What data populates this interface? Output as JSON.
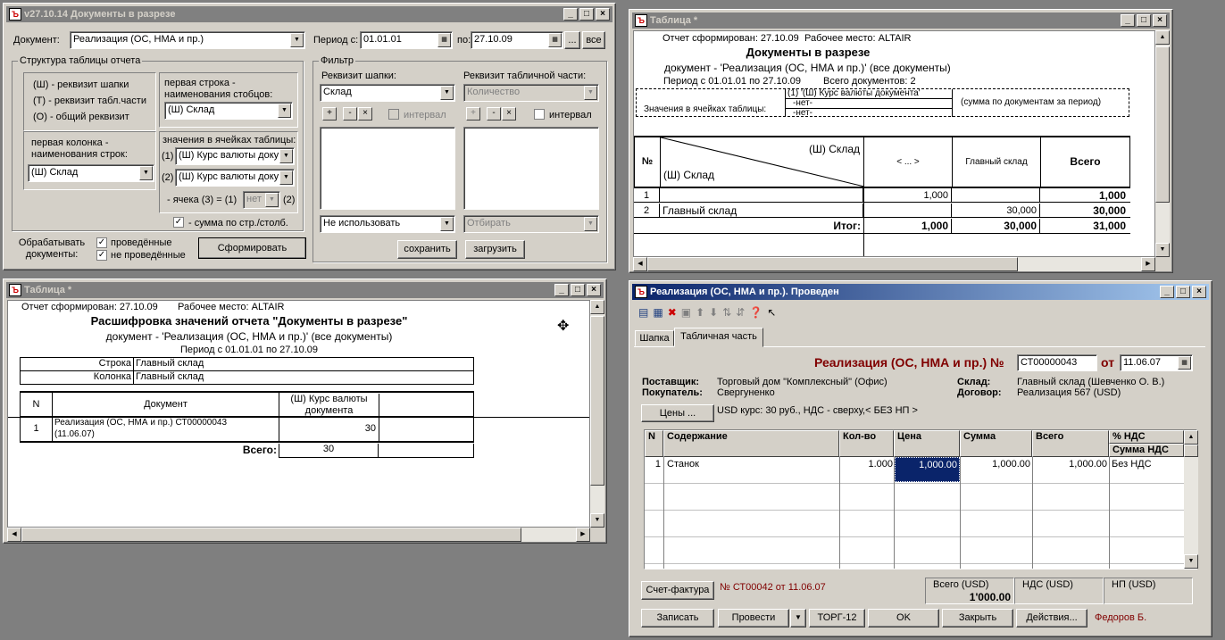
{
  "w1": {
    "title": "v27.10.14  Документы в разрезе",
    "doc_label": "Документ:",
    "doc_value": "Реализация (ОС, НМА и пр.)",
    "period_label": "Период с:",
    "period_from": "01.01.01",
    "po_label": "по:",
    "period_to": "27.10.09",
    "dots_btn": "...",
    "all_btn": "все",
    "struct_title": "Структура таблицы отчета",
    "legend": [
      "(Ш) - реквизит шапки",
      "(Т) - реквизит табл.части",
      "(О) - общий реквизит"
    ],
    "first_row_label": "первая строка - наименования стобцов:",
    "first_row_value": "(Ш) Склад",
    "first_col_label": "первая колонка - наименования строк:",
    "first_col_value": "(Ш) Склад",
    "cells_label": "значения в ячейках таблицы:",
    "cell1_n": "(1)",
    "cell1_value": "(Ш) Курс валюты доку",
    "cell2_n": "(2)",
    "cell2_value": "(Ш) Курс валюты доку",
    "cell3_label": "- ячека (3)  =  (1)",
    "cell3_value": "нет",
    "cell3_n": "(2)",
    "sum_label": "- сумма по стр./столб.",
    "filter_title": "Фильтр",
    "filter_head_label": "Реквизит шапки:",
    "filter_head_value": "Склад",
    "filter_tab_label": "Реквизит табличной части:",
    "filter_tab_value": "Количество",
    "interval_label": "интервал",
    "interval2_label": "интервал",
    "filter_left_bottom": "Не использовать",
    "filter_right_bottom": "Отбирать",
    "process_label": "Обрабатывать документы:",
    "posted_label": "проведённые",
    "unposted_label": "не проведённые",
    "form_btn": "Сформировать",
    "save_btn": "сохранить",
    "load_btn": "загрузить"
  },
  "w2": {
    "title": "Таблица  *",
    "generated": "Отчет сформирован: 27.10.09",
    "workplace": "Рабочее место: ALTAIR",
    "heading": "Документы в разрезе",
    "doc_line": "документ - 'Реализация (ОС, НМА и пр.)'   (все документы)",
    "period": "Период с 01.01.01 по 27.10.09",
    "total_docs": "Всего  документов: 2",
    "cells_label": "Значения в ячейках таблицы:",
    "cell1": "(1) '(Ш) Курс валюты документа'",
    "cell2": "-нет-",
    "cell3": "-нет-",
    "sum_note": "(сумма по документам за период)",
    "hdr_no": "№",
    "hdr_diag_top": "(Ш) Склад",
    "hdr_diag_bottom": "(Ш) Склад",
    "hdr_c1": "< ... >",
    "hdr_c2": "Главный склад",
    "hdr_c3": "Всего",
    "rows": [
      {
        "n": "1",
        "name": "",
        "c1": "1,000",
        "c2": "",
        "c3": "1,000"
      },
      {
        "n": "2",
        "name": "Главный склад",
        "c1": "",
        "c2": "30,000",
        "c3": "30,000"
      }
    ],
    "total_label": "Итог:",
    "total_c1": "1,000",
    "total_c2": "30,000",
    "total_c3": "31,000"
  },
  "w3": {
    "title": "Таблица  *",
    "generated": "Отчет сформирован: 27.10.09",
    "workplace": "Рабочее место: ALTAIR",
    "heading": "Расшифровка значений отчета \"Документы в разрезе\"",
    "doc_line": "документ - 'Реализация (ОС, НМА и пр.)'   (все документы)",
    "period": "Период с 01.01.01 по 27.10.09",
    "row_label": "Строка",
    "row_value": "Главный склад",
    "col_label": "Колонка",
    "col_value": "Главный склад",
    "hdr_n": "N",
    "hdr_doc": "Документ",
    "hdr_rate": "(Ш) Курс валюты документа",
    "r1_n": "1",
    "r1_doc1": "Реализация (ОС, НМА и пр.) СТ00000043",
    "r1_doc2": "(11.06.07)",
    "r1_val": "30",
    "total_label": "Всего:",
    "total_val": "30"
  },
  "w4": {
    "title": "Реализация (ОС, НМА и пр.). Проведен",
    "tab1": "Шапка",
    "tab2": "Табличная часть",
    "doc_heading": "Реализация (ОС, НМА и пр.) №",
    "doc_number": "СТ00000043",
    "ot_label": "от",
    "doc_date": "11.06.07",
    "supplier_label": "Поставщик:",
    "supplier": "Торговый дом \"Комплексный\" (Офис)",
    "buyer_label": "Покупатель:",
    "buyer": "Свергуненко",
    "warehouse_label": "Склад:",
    "warehouse": "Главный склад (Шевченко О. В.)",
    "contract_label": "Договор:",
    "contract": "Реализация 567 (USD)",
    "prices_btn": "Цены ...",
    "rate_info": "USD курс: 30 руб., НДС - сверху,< БЕЗ НП >",
    "cols": [
      "N",
      "Содержание",
      "Кол-во",
      "Цена",
      "Сумма",
      "Всего",
      "% НДС",
      "Сумма НДС"
    ],
    "rows": [
      {
        "n": "1",
        "name": "Станок",
        "qty": "1.000",
        "price": "1,000.00",
        "sum": "1,000.00",
        "total": "1,000.00",
        "vat": "Без НДС"
      }
    ],
    "invoice_btn": "Счет-фактура",
    "invoice_ref": "№ СТ00042 от 11.06.07",
    "total_usd_label": "Всего (USD)",
    "total_usd": "1'000.00",
    "vat_usd_label": "НДС (USD)",
    "np_usd_label": "НП (USD)",
    "write_btn": "Записать",
    "post_btn": "Провести",
    "torg_btn": "ТОРГ-12",
    "ok_btn": "OK",
    "close_btn": "Закрыть",
    "actions_btn": "Действия...",
    "user": "Федоров Б."
  }
}
